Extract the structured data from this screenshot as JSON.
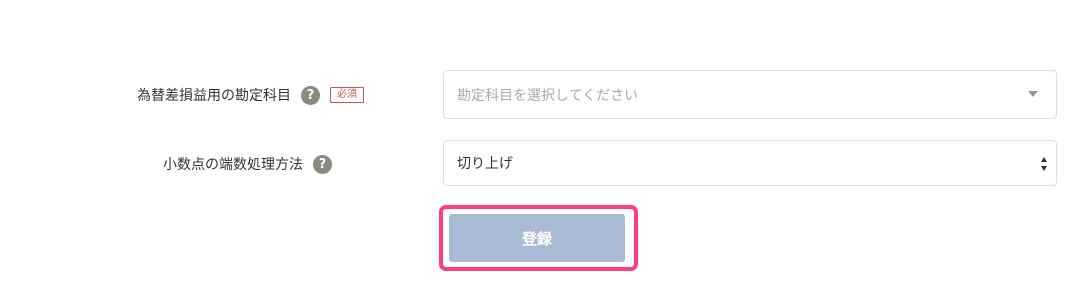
{
  "form": {
    "account_field": {
      "label": "為替差損益用の勘定科目",
      "help_icon_glyph": "?",
      "required_badge": "必須",
      "placeholder": "勘定科目を選択してください"
    },
    "rounding_field": {
      "label": "小数点の端数処理方法",
      "help_icon_glyph": "?",
      "selected_value": "切り上げ"
    },
    "submit_button": {
      "label": "登録"
    }
  },
  "colors": {
    "accent_highlight": "#ff3d7f",
    "button_bg": "#a9bbd4",
    "required_red": "#d9534f",
    "help_icon_gray": "#8a8a80"
  },
  "icons": {
    "help": "question-circle-icon",
    "dropdown": "caret-down-icon",
    "select_arrows": "sort-updown-icon"
  }
}
